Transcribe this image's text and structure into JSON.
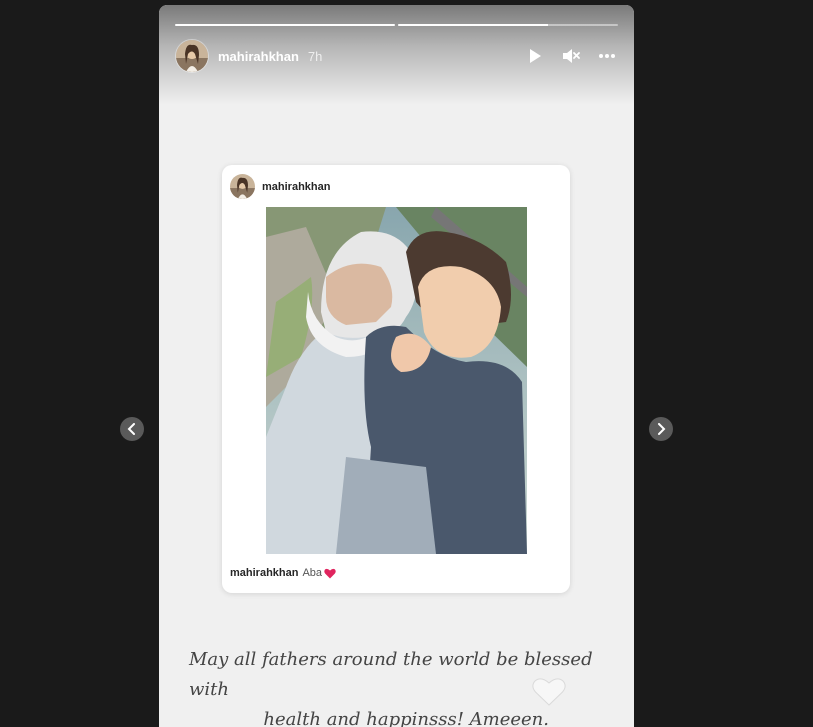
{
  "story": {
    "username": "mahirahkhan",
    "time_ago": "7h",
    "progress": [
      1.0,
      0.68
    ],
    "controls": {
      "play_icon": "play-icon",
      "mute_icon": "muted-speaker-icon",
      "more_icon": "more-horizontal-icon"
    }
  },
  "post": {
    "username": "mahirahkhan",
    "caption_user": "mahirahkhan",
    "caption_text": "Aba",
    "caption_emoji": "red-heart-icon"
  },
  "quote": {
    "line1": "May all fathers around the world be blessed with",
    "line2": "health and happinsss! Ameeen.",
    "emoji": "white-heart-icon"
  },
  "nav": {
    "prev_icon": "chevron-left-icon",
    "next_icon": "chevron-right-icon"
  },
  "colors": {
    "background": "#1a1a1a",
    "story_bg": "#f0f0f0",
    "heart": "#e0245e"
  }
}
